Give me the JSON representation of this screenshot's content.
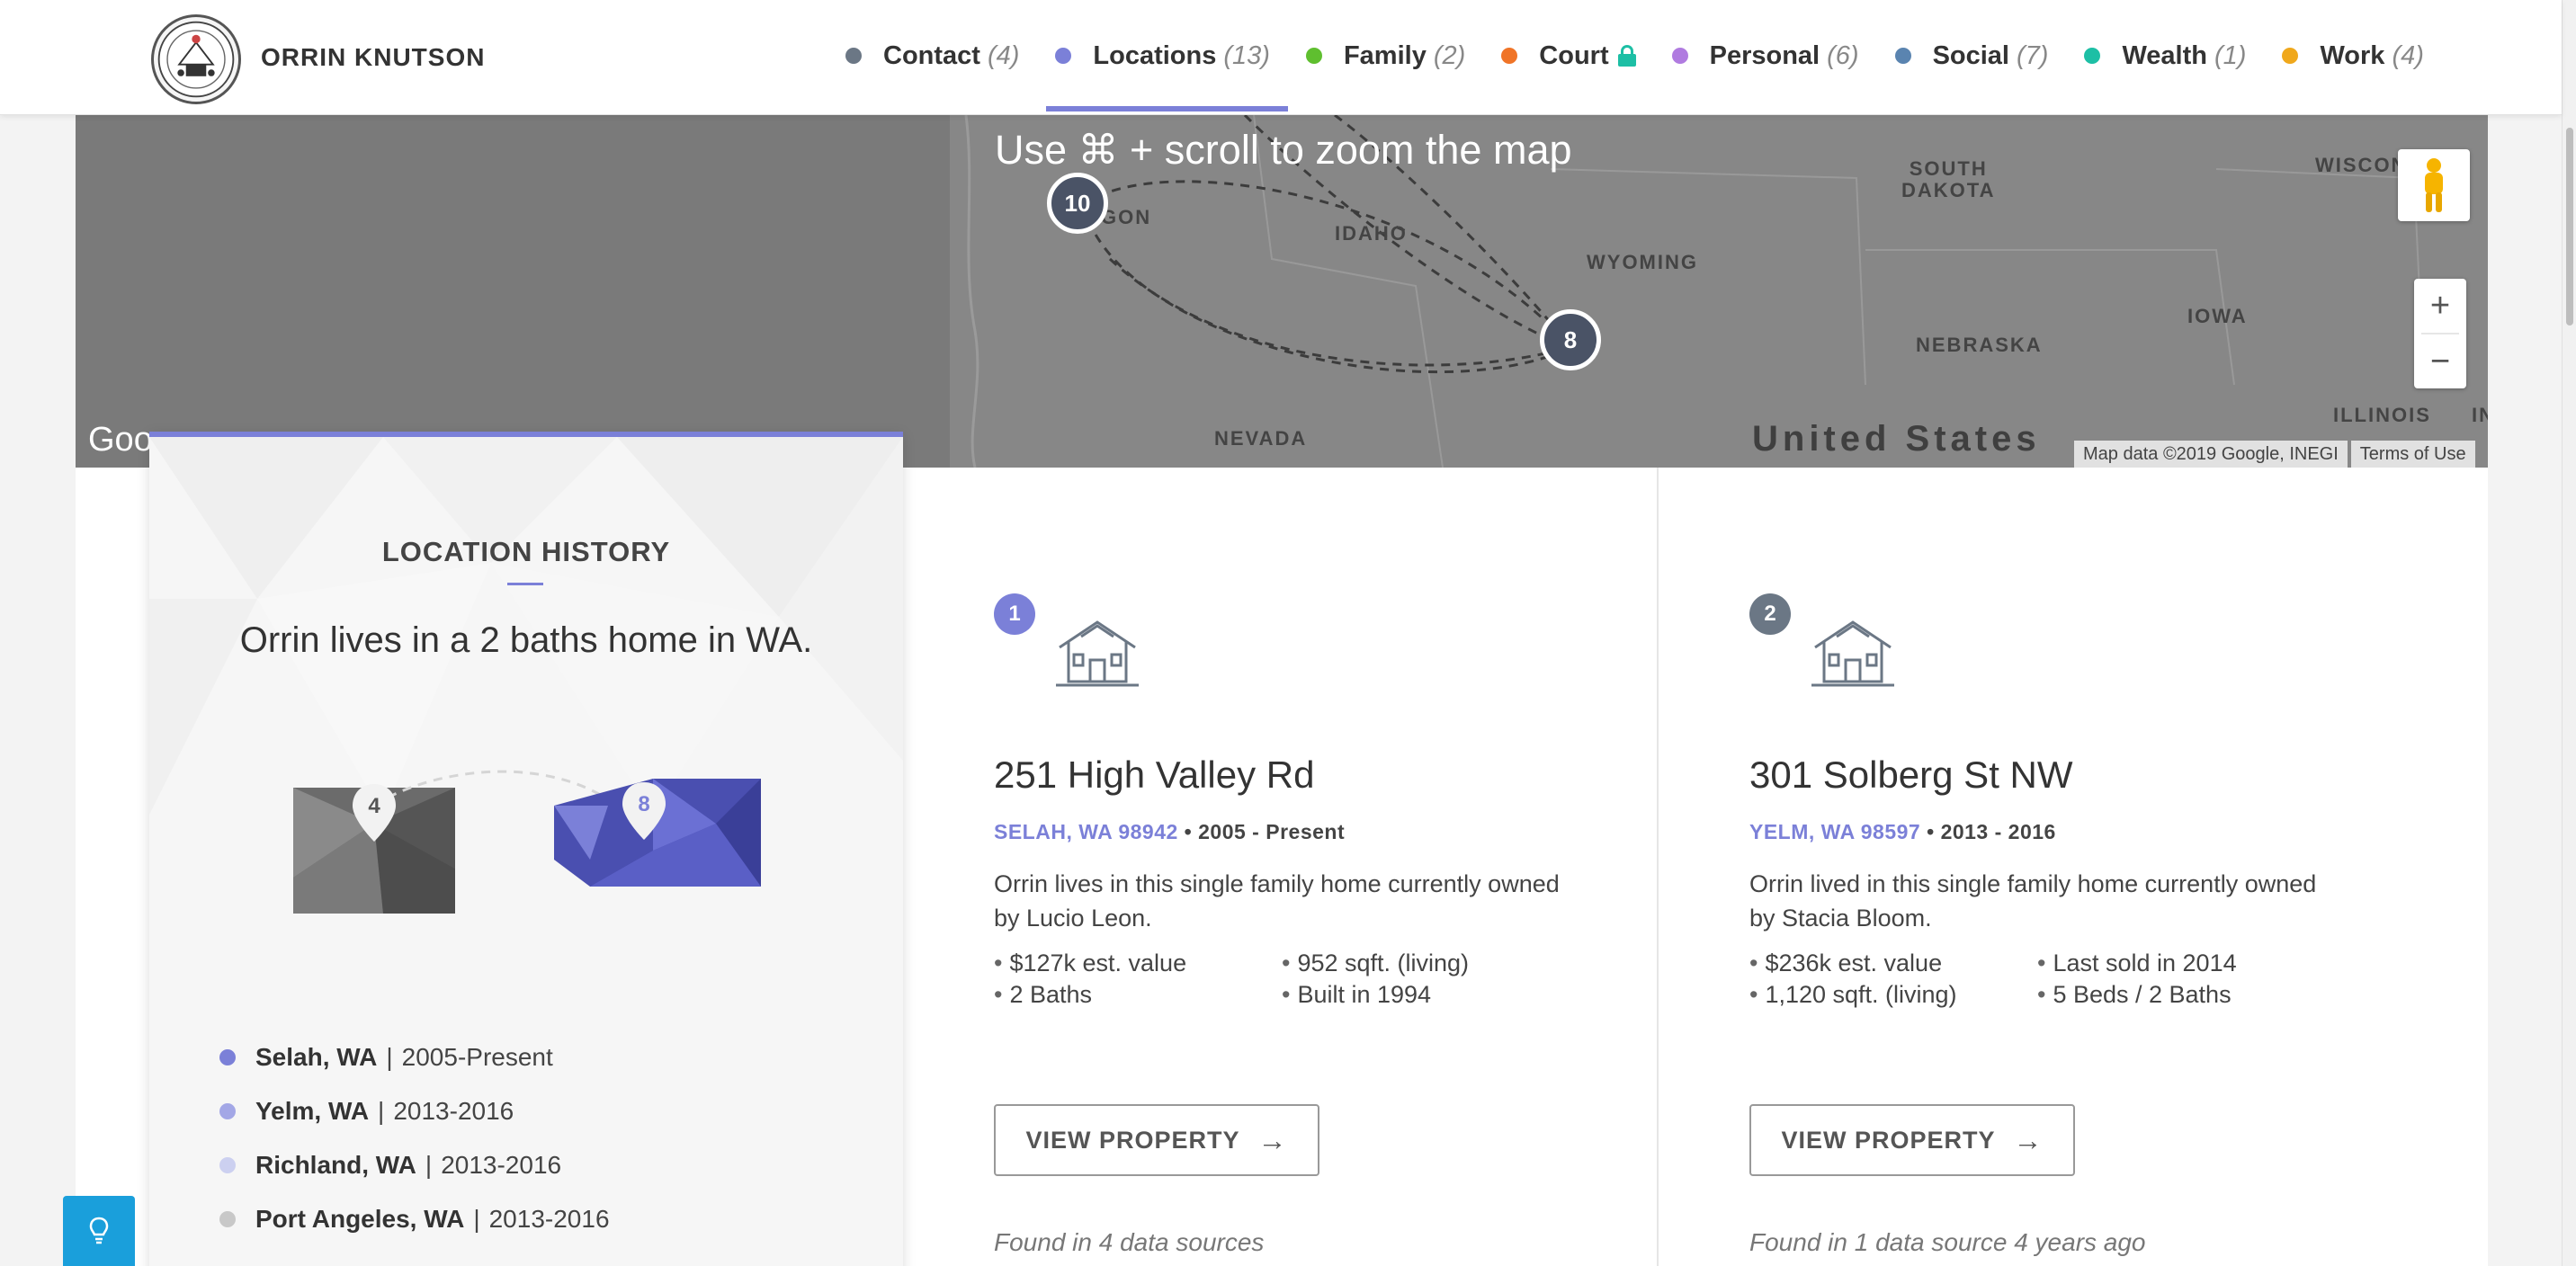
{
  "header": {
    "person_name": "ORRIN KNUTSON",
    "logo_icon": "seal-logo",
    "nav": [
      {
        "label": "Contact",
        "count": "(4)",
        "color": "#6b7785",
        "active": false
      },
      {
        "label": "Locations",
        "count": "(13)",
        "color": "#7b80d8",
        "active": true
      },
      {
        "label": "Family",
        "count": "(2)",
        "color": "#5fbf2f",
        "active": false
      },
      {
        "label": "Court",
        "count": "",
        "color": "#f07427",
        "active": false,
        "locked": true
      },
      {
        "label": "Personal",
        "count": "(6)",
        "color": "#b07be0",
        "active": false
      },
      {
        "label": "Social",
        "count": "(7)",
        "color": "#5a84b0",
        "active": false
      },
      {
        "label": "Wealth",
        "count": "(1)",
        "color": "#1dbfa5",
        "active": false
      },
      {
        "label": "Work",
        "count": "(4)",
        "color": "#f0a81c",
        "active": false
      }
    ]
  },
  "map": {
    "hint": "Use ⌘ + scroll to zoom the map",
    "states": {
      "oregon": "GON",
      "idaho": "IDAHO",
      "wyoming": "WYOMING",
      "south_dakota": "SOUTH\nDAKOTA",
      "nebraska": "NEBRASKA",
      "iowa": "IOWA",
      "nevada": "NEVADA",
      "illinois": "ILLINOIS",
      "wisconsin": "WISCON",
      "indiana": "IN"
    },
    "country": "United States",
    "clusters": [
      "10",
      "8"
    ],
    "zoom_in": "+",
    "zoom_out": "−",
    "google": "Goo",
    "attribution": "Map data ©2019 Google, INEGI",
    "terms": "Terms of Use"
  },
  "location_history": {
    "title": "LOCATION HISTORY",
    "summary": "Orrin lives in a 2 baths home in WA.",
    "graphic_pins": [
      "4",
      "8"
    ],
    "items": [
      {
        "city": "Selah, WA",
        "years": "2005-Present",
        "color": "#7b80d8"
      },
      {
        "city": "Yelm, WA",
        "years": "2013-2016",
        "color": "#a3a7e6"
      },
      {
        "city": "Richland, WA",
        "years": "2013-2016",
        "color": "#ccd0f0"
      },
      {
        "city": "Port Angeles, WA",
        "years": "2013-2016",
        "color": "#c8c8c8"
      }
    ]
  },
  "properties": [
    {
      "number": "1",
      "number_color": "#7b80d8",
      "address": "251 High Valley Rd",
      "location": "SELAH, WA 98942",
      "period": "2005 - Present",
      "description": "Orrin lives in this single family home currently owned by Lucio Leon.",
      "facts": [
        "$127k est. value",
        "952 sqft. (living)",
        "2 Baths",
        "Built in 1994"
      ],
      "button": "VIEW PROPERTY",
      "sources": "Found in 4 data sources"
    },
    {
      "number": "2",
      "number_color": "#6b7785",
      "address": "301 Solberg St NW",
      "location": "YELM, WA 98597",
      "period": "2013 - 2016",
      "description": "Orrin lived in this single family home currently owned by Stacia Bloom.",
      "facts": [
        "$236k est. value",
        "Last sold in 2014",
        "1,120 sqft. (living)",
        "5 Beds / 2 Baths"
      ],
      "button": "VIEW PROPERTY",
      "sources": "Found in 1 data source 4 years ago"
    }
  ]
}
